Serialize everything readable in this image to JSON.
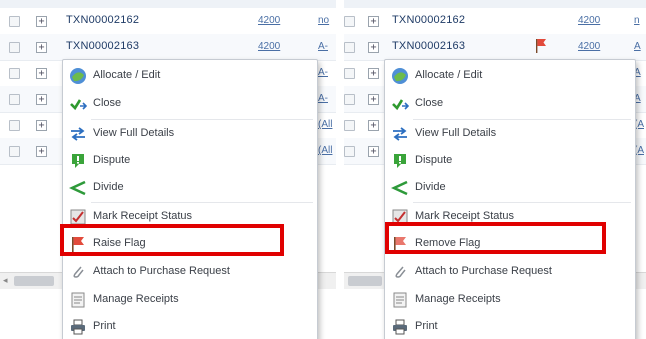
{
  "left": {
    "rows": [
      {
        "txn": "TXN00002162",
        "amount": "4200",
        "col3": "no"
      },
      {
        "txn": "TXN00002163",
        "amount": "4200",
        "col3": "A-"
      },
      {
        "col3": "A-"
      },
      {
        "col3": "A-"
      },
      {
        "col3": "(All"
      },
      {
        "col3": "(All"
      }
    ],
    "menu": {
      "items": [
        {
          "label": "Allocate / Edit",
          "icon": "allocate-edit-icon"
        },
        {
          "label": "Close",
          "icon": "close-check-icon"
        },
        {
          "label": "View Full Details",
          "icon": "view-details-icon"
        },
        {
          "label": "Dispute",
          "icon": "dispute-icon"
        },
        {
          "label": "Divide",
          "icon": "divide-icon"
        },
        {
          "label": "Mark Receipt Status",
          "icon": "mark-receipt-icon"
        },
        {
          "label": "Raise Flag",
          "icon": "flag-icon"
        },
        {
          "label": "Attach to Purchase Request",
          "icon": "paperclip-icon"
        },
        {
          "label": "Manage Receipts",
          "icon": "receipts-icon"
        },
        {
          "label": "Print",
          "icon": "printer-icon"
        }
      ],
      "highlighted_item": "Raise Flag"
    }
  },
  "right": {
    "rows": [
      {
        "txn": "TXN00002162",
        "amount": "4200",
        "col3": "n"
      },
      {
        "txn": "TXN00002163",
        "amount": "4200",
        "col3": "A",
        "flagged": true
      },
      {
        "col3": "A"
      },
      {
        "col3": "A"
      },
      {
        "col3": "(A"
      },
      {
        "col3": "(A"
      }
    ],
    "menu": {
      "items": [
        {
          "label": "Allocate / Edit",
          "icon": "allocate-edit-icon"
        },
        {
          "label": "Close",
          "icon": "close-check-icon"
        },
        {
          "label": "View Full Details",
          "icon": "view-details-icon"
        },
        {
          "label": "Dispute",
          "icon": "dispute-icon"
        },
        {
          "label": "Divide",
          "icon": "divide-icon"
        },
        {
          "label": "Mark Receipt Status",
          "icon": "mark-receipt-icon"
        },
        {
          "label": "Remove Flag",
          "icon": "flag-icon"
        },
        {
          "label": "Attach to Purchase Request",
          "icon": "paperclip-icon"
        },
        {
          "label": "Manage Receipts",
          "icon": "receipts-icon"
        },
        {
          "label": "Print",
          "icon": "printer-icon"
        }
      ],
      "highlighted_item": "Remove Flag"
    }
  },
  "colors": {
    "highlight": "#e00000",
    "link": "#4a6fa5",
    "txn_text": "#1f3b66"
  }
}
